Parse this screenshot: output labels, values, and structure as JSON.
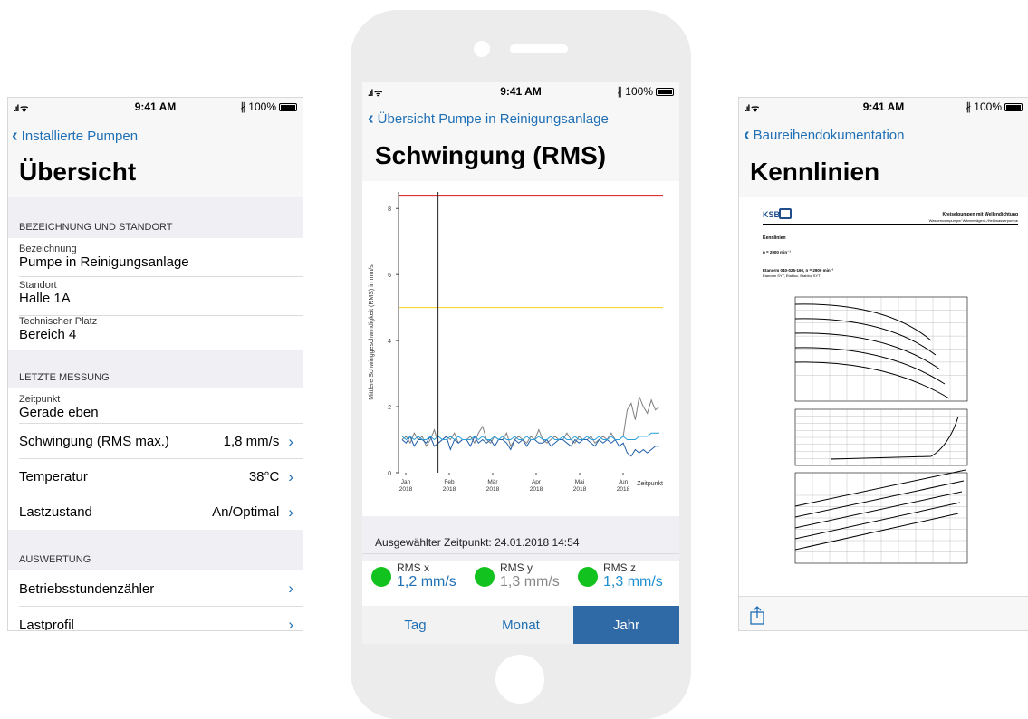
{
  "left_screen": {
    "status": {
      "signal": "..ll",
      "time": "9:41 AM",
      "battery": "100%"
    },
    "back_label": "Installierte Pumpen",
    "title": "Übersicht",
    "section1": "BEZEICHNUNG UND STANDORT",
    "fields": [
      {
        "label": "Bezeichnung",
        "value": "Pumpe in Reinigungsanlage"
      },
      {
        "label": "Standort",
        "value": "Halle 1A"
      },
      {
        "label": "Technischer Platz",
        "value": "Bereich 4"
      }
    ],
    "section2": "LETZTE MESSUNG",
    "zeitpunkt": {
      "label": "Zeitpunkt",
      "value": "Gerade eben"
    },
    "rows": [
      {
        "label": "Schwingung (RMS max.)",
        "value": "1,8 mm/s"
      },
      {
        "label": "Temperatur",
        "value": "38°C"
      },
      {
        "label": "Lastzustand",
        "value": "An/Optimal"
      }
    ],
    "section3": "AUSWERTUNG",
    "rows2": [
      {
        "label": "Betriebsstundenzähler"
      },
      {
        "label": "Lastprofil"
      }
    ]
  },
  "middle_screen": {
    "status": {
      "time": "9:41 AM",
      "battery": "100%"
    },
    "back_label": "Übersicht Pumpe in Reinigungsanlage",
    "title": "Schwingung (RMS)",
    "selected_time": "Ausgewählter Zeitpunkt: 24.01.2018 14:54",
    "sensors": [
      {
        "name": "RMS x",
        "value": "1,2 mm/s",
        "color": "#1f6fb5"
      },
      {
        "name": "RMS y",
        "value": "1,3 mm/s",
        "color": "#888888"
      },
      {
        "name": "RMS z",
        "value": "1,3 mm/s",
        "color": "#1f8fd0"
      }
    ],
    "segments": [
      "Tag",
      "Monat",
      "Jahr"
    ],
    "active_segment": "Jahr"
  },
  "right_screen": {
    "status": {
      "time": "9:41 AM",
      "battery": "100%"
    },
    "back_label": "Baureihendokumentation",
    "title": "Kennlinien",
    "doc": {
      "logo": "KSB",
      "header_title": "Kreiselpumpen mit Wellendichtung",
      "header_sub": "Wassernormpumpe/ Wärmeträgerö-/Heißwasserpumpe",
      "section": "Kennlinien",
      "speed": "n = 2900 min⁻¹",
      "model": "Etanorm 040-025-160, n = 2900 min⁻¹",
      "model_sub": "Etanorm SYT, Etabloc, Etabloc SYT"
    }
  },
  "chart_data": {
    "type": "line",
    "title": "",
    "xlabel": "Zeitpunkt",
    "ylabel": "Mittlere Schwinggeschwindigkeit (RMS) in mm/s",
    "ylim": [
      0,
      8.5
    ],
    "y_ticks": [
      0,
      2,
      4,
      6,
      8
    ],
    "x_ticks": [
      {
        "label": "Jan",
        "sub": "2018"
      },
      {
        "label": "Feb",
        "sub": "2018"
      },
      {
        "label": "Mär",
        "sub": "2018"
      },
      {
        "label": "Apr",
        "sub": "2018"
      },
      {
        "label": "Mai",
        "sub": "2018"
      },
      {
        "label": "Jun",
        "sub": "2018"
      }
    ],
    "thresholds": [
      {
        "value": 8.4,
        "color": "#e0141e"
      },
      {
        "value": 5.0,
        "color": "#f2d21c"
      }
    ],
    "cursor": "24.01.2018",
    "series": [
      {
        "color": "#7f7f7f",
        "values": [
          1.0,
          1.1,
          0.9,
          1.2,
          1.0,
          1.1,
          0.8,
          1.0,
          1.3,
          0.9,
          1.0,
          1.1,
          1.0,
          1.2,
          0.9,
          1.0,
          1.0,
          1.1,
          0.9,
          1.2,
          1.4,
          1.0,
          0.9,
          1.1,
          1.0,
          1.0,
          1.2,
          0.8,
          1.0,
          1.1,
          1.0,
          0.9,
          1.1,
          1.0,
          1.3,
          1.0,
          0.9,
          1.0,
          1.1,
          1.0,
          1.0,
          1.2,
          1.0,
          0.9,
          1.1,
          1.0,
          1.0,
          1.1,
          0.9,
          1.0,
          1.1,
          1.0,
          1.2,
          1.0,
          1.0,
          1.1,
          1.9,
          2.1,
          1.6,
          2.3,
          2.0,
          1.8,
          2.2,
          1.9,
          2.0
        ]
      },
      {
        "color": "#1f5fa8",
        "values": [
          1.0,
          0.9,
          1.1,
          0.8,
          1.0,
          1.0,
          0.9,
          1.1,
          0.8,
          0.9,
          1.0,
          1.1,
          0.7,
          1.0,
          0.9,
          1.0,
          1.0,
          0.8,
          1.1,
          0.9,
          1.0,
          0.9,
          1.0,
          0.8,
          1.0,
          1.0,
          0.9,
          0.7,
          1.0,
          0.9,
          1.0,
          0.8,
          1.0,
          1.0,
          0.9,
          0.9,
          1.0,
          0.8,
          0.9,
          1.0,
          1.0,
          0.9,
          0.8,
          1.0,
          0.9,
          1.0,
          1.0,
          0.9,
          0.8,
          1.0,
          0.9,
          1.0,
          0.9,
          1.0,
          0.8,
          0.9,
          0.6,
          0.5,
          0.7,
          0.6,
          0.7,
          0.6,
          0.7,
          0.8,
          0.8
        ]
      },
      {
        "color": "#2aa0dc",
        "values": [
          1.1,
          1.0,
          1.1,
          1.0,
          1.1,
          1.0,
          1.0,
          1.1,
          1.0,
          1.1,
          1.0,
          1.0,
          1.1,
          1.0,
          1.1,
          1.0,
          1.0,
          1.0,
          1.1,
          1.0,
          1.1,
          1.0,
          1.0,
          1.1,
          1.0,
          1.1,
          1.0,
          1.0,
          1.1,
          1.0,
          1.0,
          1.1,
          1.0,
          1.0,
          1.1,
          1.0,
          1.0,
          1.1,
          1.0,
          1.0,
          1.1,
          1.0,
          1.0,
          1.1,
          1.0,
          1.0,
          1.1,
          1.0,
          1.0,
          1.1,
          1.0,
          1.0,
          1.1,
          1.0,
          1.0,
          1.1,
          1.0,
          1.0,
          1.0,
          1.1,
          1.1,
          1.1,
          1.2,
          1.2,
          1.2
        ]
      }
    ]
  }
}
